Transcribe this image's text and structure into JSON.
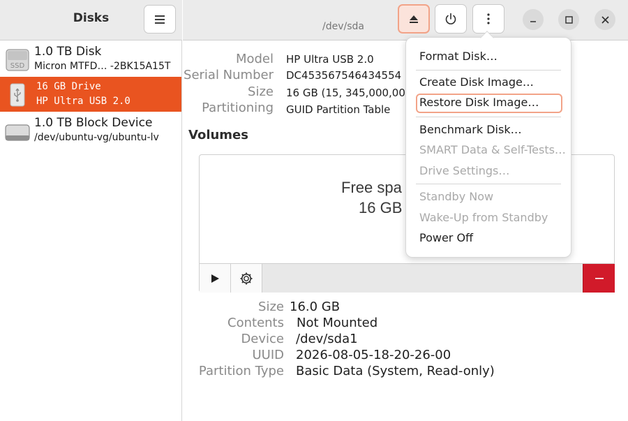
{
  "sidebar": {
    "title": "Disks",
    "items": [
      {
        "name": "1.0 TB Disk",
        "sub": "Micron MTFD… -2BK15A15T",
        "icon": "ssd-drive-icon"
      },
      {
        "name": "16 GB Drive",
        "sub": "HP Ultra USB 2.0",
        "icon": "usb-drive-icon"
      },
      {
        "name": "1.0 TB Block Device",
        "sub": "/dev/ubuntu-vg/ubuntu-lv",
        "icon": "block-device-icon"
      }
    ],
    "ssd_badge": "SSD"
  },
  "header": {
    "subtitle": "/dev/sda",
    "buttons": [
      "eject-icon",
      "power-icon",
      "more-vertical-icon",
      "minimize-icon",
      "maximize-icon",
      "close-icon"
    ]
  },
  "drive": {
    "labels": {
      "model": "Model",
      "serial": "Serial Number",
      "size": "Size",
      "partitioning": "Partitioning"
    },
    "values": {
      "model": "HP Ultra USB 2.0",
      "serial": "DC453567546434554",
      "size": "16 GB (15, 345,000,00",
      "partitioning": "GUID Partition Table"
    }
  },
  "volumes": {
    "title": "Volumes",
    "free_label": "Free spa",
    "free_size": "16 GB"
  },
  "partition": {
    "labels": {
      "size": "Size",
      "contents": "Contents",
      "device": "Device",
      "uuid": "UUID",
      "type": "Partition Type"
    },
    "values": {
      "size": "16.0 GB",
      "contents": "Not Mounted",
      "device": "/dev/sda1",
      "uuid": "2026-08-05-18-20-26-00",
      "type": "Basic Data (System, Read-only)"
    }
  },
  "menu": {
    "items": [
      {
        "label": "Format Disk…",
        "enabled": true
      },
      {
        "label": "Create Disk Image…",
        "enabled": true
      },
      {
        "label": "Restore Disk Image…",
        "enabled": true,
        "focused": true
      },
      {
        "label": "Benchmark Disk…",
        "enabled": true
      },
      {
        "label": "SMART Data & Self-Tests…",
        "enabled": false
      },
      {
        "label": "Drive Settings…",
        "enabled": false
      },
      {
        "label": "Standby Now",
        "enabled": false
      },
      {
        "label": "Wake-Up from Standby",
        "enabled": false
      },
      {
        "label": "Power Off",
        "enabled": true
      }
    ]
  },
  "colors": {
    "accent": "#e95420",
    "danger": "#d11a2a",
    "focus_ring": "#f2a388"
  }
}
